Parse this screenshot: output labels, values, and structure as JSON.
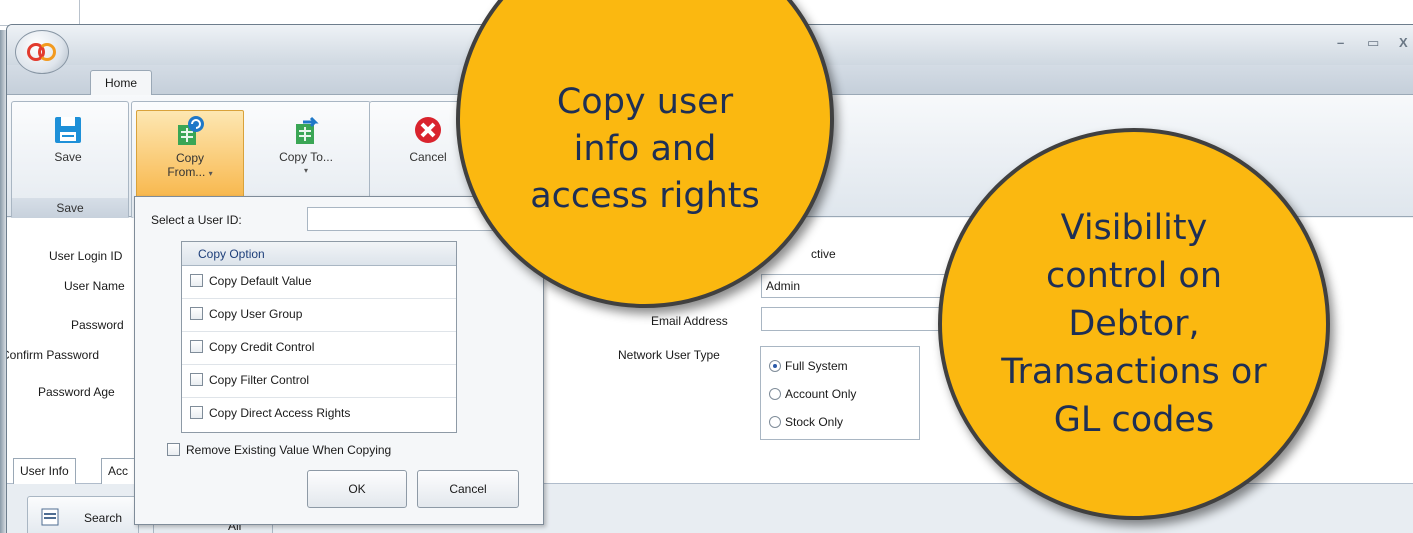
{
  "window": {
    "tab_home": "Home",
    "controls": {
      "minimize": "–",
      "maximize": "▭",
      "close": "X"
    }
  },
  "ribbon": {
    "save_label": "Save",
    "copy_from_label_line1": "Copy",
    "copy_from_label_line2": "From...",
    "copy_to_label": "Copy To...",
    "cancel_label": "Cancel",
    "group_save_label": "Save",
    "caret": "▾"
  },
  "form": {
    "user_login_id": "User Login ID",
    "user_name": "User Name",
    "password": "Password",
    "confirm_password": "Confirm Password",
    "password_age": "Password Age",
    "active_fragment": "ctive",
    "user_group_value": "Admin",
    "email_fragment": "Email Address",
    "network_user_type": "Network User Type",
    "radio": [
      "Full System",
      "Account Only",
      "Stock Only"
    ],
    "radio_selected": 0
  },
  "tabs": {
    "user_info": "User Info",
    "access_fragment": "Acc"
  },
  "lower": {
    "search_label": "Search",
    "second_fragment": "All"
  },
  "popup": {
    "select_label": "Select a User ID:",
    "option_header": "Copy Option",
    "options": [
      "Copy Default Value",
      "Copy User Group",
      "Copy Credit Control",
      "Copy Filter Control",
      "Copy Direct Access Rights"
    ],
    "remove_existing": "Remove Existing Value When Copying",
    "ok_label": "OK",
    "cancel_label": "Cancel"
  },
  "callouts": {
    "left": [
      "Copy user",
      "info and",
      "access rights"
    ],
    "right": [
      "Visibility",
      "control on",
      "Debtor,",
      "Transactions or",
      "GL codes"
    ]
  },
  "colors": {
    "callout_fill": "#fbb810",
    "callout_text": "#1e2f55",
    "active_button": "#f8b84e"
  }
}
